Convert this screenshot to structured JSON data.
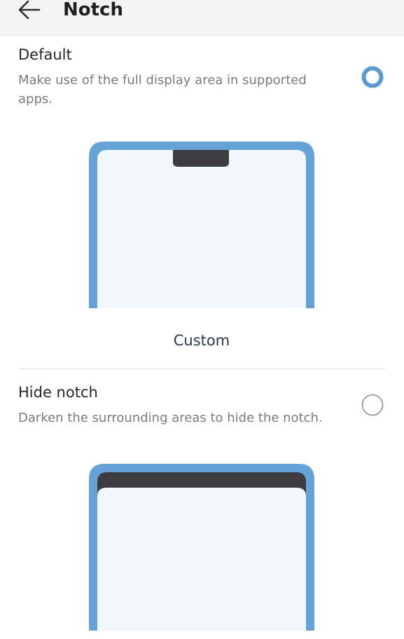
{
  "header": {
    "title": "Notch",
    "back_icon": "arrow-left-icon"
  },
  "options": [
    {
      "title": "Default",
      "description": "Make use of the full display area in supported apps.",
      "selected": true,
      "action_label": "Custom"
    },
    {
      "title": "Hide notch",
      "description": "Darken the surrounding areas to hide the notch.",
      "selected": false
    }
  ],
  "colors": {
    "accent": "#5b9bd5",
    "phone_frame": "#65a2d8",
    "phone_screen": "#f3f8fd",
    "notch": "#3c3c3e",
    "radio_unselected": "#9a9a9a"
  }
}
